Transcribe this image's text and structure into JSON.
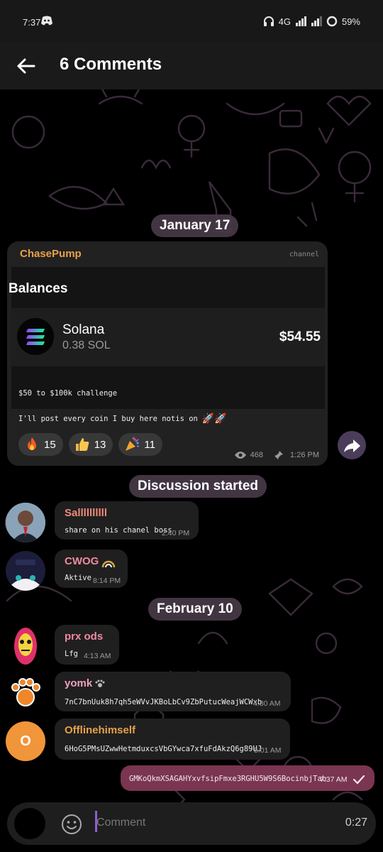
{
  "status": {
    "time": "7:37",
    "network": "4G",
    "battery": "59%"
  },
  "header": {
    "title": "6 Comments"
  },
  "date_pills": [
    "January 17",
    "Discussion started",
    "February 10"
  ],
  "post": {
    "author": "ChasePump",
    "tag": "channel",
    "image": {
      "heading": "Balances",
      "coin_name": "Solana",
      "coin_amount": "0.38 SOL",
      "coin_value": "$54.55"
    },
    "line1": "$50 to $100k challenge",
    "line2": "I'll post every coin I buy here notis on",
    "reactions": [
      {
        "icon": "fire-emoji-icon",
        "count": "15"
      },
      {
        "icon": "thumbs-up-emoji-icon",
        "count": "13"
      },
      {
        "icon": "party-popper-emoji-icon",
        "count": "11"
      }
    ],
    "views": "468",
    "time": "1:26 PM"
  },
  "comments": [
    {
      "name": "Sallllllllll",
      "name_color": "#f08a7a",
      "text": "share on his chanel boss",
      "time": "2:40 PM"
    },
    {
      "name": "CWOG",
      "name_color": "#f08aa0",
      "text": "Aktive",
      "time": "8:14 PM"
    },
    {
      "name": "prx ods",
      "name_color": "#f08aa0",
      "text": "Lfg",
      "time": "4:13 AM"
    },
    {
      "name": "yomk",
      "name_color": "#f0a0c0",
      "text": "7nC7bnUuk8h7qh5eWVvJKBoLbCv9ZbPutucWeajWCWxb",
      "time": "4:30 AM"
    },
    {
      "name": "Offlinehimself",
      "name_color": "#e8a14a",
      "text": "6HoG5PMsUZwwHetmduxcsVbGYwca7xfuFdAkzQ6g89UJ",
      "time": "5:01 AM",
      "avatar_letter": "O"
    }
  ],
  "outgoing": {
    "text": "GMKoQkmXSAGAHYxvfsipFmxe3RGHU5W9S6BocinbjTab",
    "time": "7:37 AM"
  },
  "composer": {
    "placeholder": "Comment",
    "duration": "0:27"
  }
}
